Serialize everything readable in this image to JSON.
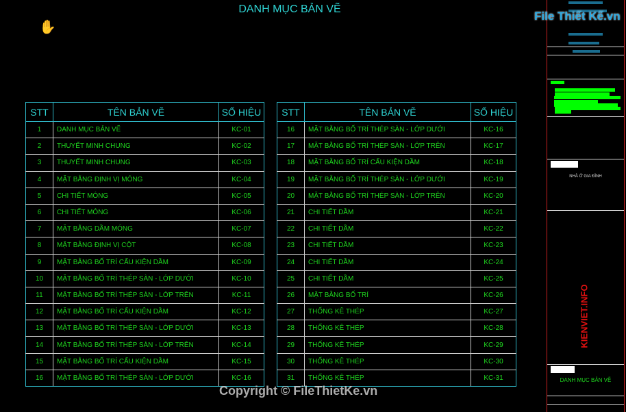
{
  "title": "DANH MỤC BẢN VẼ",
  "headers": {
    "stt": "STT",
    "name": "TÊN BẢN VẼ",
    "code": "SỐ HIỆU"
  },
  "left_rows": [
    [
      "1",
      "DANH MỤC BẢN VẼ",
      "KC-01"
    ],
    [
      "2",
      "THUYẾT MINH CHUNG",
      "KC-02"
    ],
    [
      "3",
      "THUYẾT MINH CHUNG",
      "KC-03"
    ],
    [
      "4",
      "MẶT BẰNG ĐỊNH VỊ MÓNG",
      "KC-04"
    ],
    [
      "5",
      "CHI TIẾT MÓNG",
      "KC-05"
    ],
    [
      "6",
      "CHI TIẾT MÓNG",
      "KC-06"
    ],
    [
      "7",
      "MẶT BẰNG DẦM MÓNG",
      "KC-07"
    ],
    [
      "8",
      "MẶT BẰNG ĐỊNH VỊ CỘT",
      "KC-08"
    ],
    [
      "9",
      "MẶT BẰNG BỐ TRÍ CẤU KIỆN DẦM",
      "KC-09"
    ],
    [
      "10",
      "MẶT BẰNG BỐ TRÍ THÉP SÀN - LỚP DƯỚI",
      "KC-10"
    ],
    [
      "11",
      "MẶT BẰNG BỐ TRÍ THÉP SÀN - LỚP TRÊN",
      "KC-11"
    ],
    [
      "12",
      "MẶT BẰNG BỐ TRÍ CẤU KIỆN DẦM",
      "KC-12"
    ],
    [
      "13",
      "MẶT BẰNG BỐ TRÍ THÉP SÀN - LỚP DƯỚI",
      "KC-13"
    ],
    [
      "14",
      "MẶT BẰNG BỐ TRÍ THÉP SÀN - LỚP TRÊN",
      "KC-14"
    ],
    [
      "15",
      "MẶT BẰNG BỐ TRÍ CẤU KIỆN DẦM",
      "KC-15"
    ],
    [
      "16",
      "MẶT BẰNG BỐ TRÍ THÉP SÀN - LỚP DƯỚI",
      "KC-16"
    ]
  ],
  "right_rows": [
    [
      "16",
      "MẶT BẰNG BỐ TRÍ THÉP SÀN - LỚP DƯỚI",
      "KC-16"
    ],
    [
      "17",
      "MẶT BẰNG BỐ TRÍ THÉP SÀN - LỚP TRÊN",
      "KC-17"
    ],
    [
      "18",
      "MẶT BẰNG BỐ TRÍ CẤU KIỆN DẦM",
      "KC-18"
    ],
    [
      "19",
      "MẶT BẰNG BỐ TRÍ THÉP SÀN - LỚP DƯỚI",
      "KC-19"
    ],
    [
      "20",
      "MẶT BẰNG BỐ TRÍ THÉP SÀN - LỚP TRÊN",
      "KC-20"
    ],
    [
      "21",
      "CHI TIẾT DẦM",
      "KC-21"
    ],
    [
      "22",
      "CHI TIẾT DẦM",
      "KC-22"
    ],
    [
      "23",
      "CHI TIẾT DẦM",
      "KC-23"
    ],
    [
      "24",
      "CHI TIẾT DẦM",
      "KC-24"
    ],
    [
      "25",
      "CHI TIẾT DẦM",
      "KC-25"
    ],
    [
      "26",
      "MẶT BẰNG BỐ TRÍ",
      "KC-26"
    ],
    [
      "27",
      "THỐNG KÊ THÉP",
      "KC-27"
    ],
    [
      "28",
      "THỐNG KÊ THÉP",
      "KC-28"
    ],
    [
      "29",
      "THỐNG KÊ THÉP",
      "KC-29"
    ],
    [
      "30",
      "THỐNG KÊ THÉP",
      "KC-30"
    ],
    [
      "31",
      "THỐNG KÊ THÉP",
      "KC-31"
    ]
  ],
  "title_block": {
    "project": "NHÀ Ở GIA ĐÌNH",
    "sheet_name": "DANH MỤC BẢN VẼ"
  },
  "watermarks": {
    "logo": "File Thiết Kế.vn",
    "side": "KIENVIET.INFO",
    "copyright": "Copyright © FileThietKe.vn"
  },
  "colors": {
    "table_text": "#1fd51f",
    "header": "#2fd3d3",
    "frame": "#cc2222"
  }
}
